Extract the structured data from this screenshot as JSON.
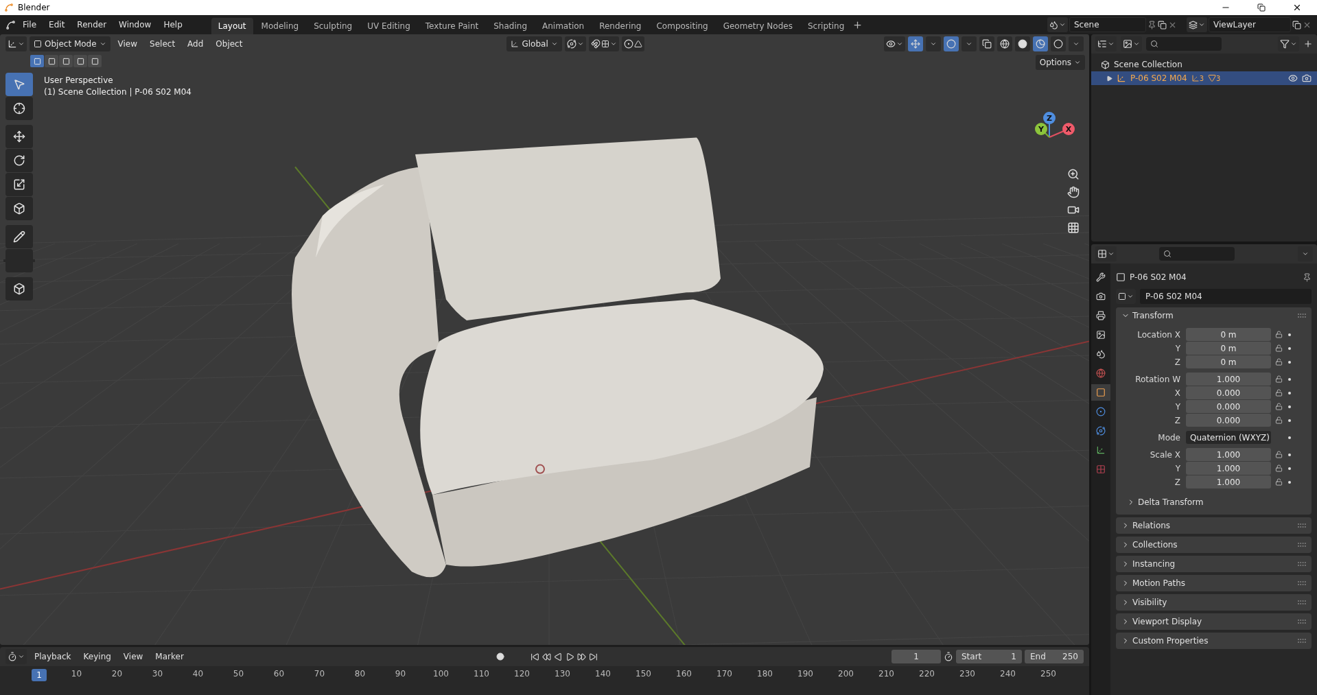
{
  "window": {
    "title": "Blender"
  },
  "menu": [
    "File",
    "Edit",
    "Render",
    "Window",
    "Help"
  ],
  "workspaces": [
    {
      "label": "Layout",
      "selected": true
    },
    {
      "label": "Modeling",
      "selected": false
    },
    {
      "label": "Sculpting",
      "selected": false
    },
    {
      "label": "UV Editing",
      "selected": false
    },
    {
      "label": "Texture Paint",
      "selected": false
    },
    {
      "label": "Shading",
      "selected": false
    },
    {
      "label": "Animation",
      "selected": false
    },
    {
      "label": "Rendering",
      "selected": false
    },
    {
      "label": "Compositing",
      "selected": false
    },
    {
      "label": "Geometry Nodes",
      "selected": false
    },
    {
      "label": "Scripting",
      "selected": false
    }
  ],
  "scene": {
    "name": "Scene"
  },
  "view_layer": {
    "name": "ViewLayer"
  },
  "viewport": {
    "mode": "Object Mode",
    "menu": [
      "View",
      "Select",
      "Add",
      "Object"
    ],
    "orientation": "Global",
    "options": "Options",
    "perspective": "User Perspective",
    "info": "(1) Scene Collection | P-06 S02 M04",
    "select_modes": [
      {
        "selected": true
      },
      {
        "selected": false
      },
      {
        "selected": false
      },
      {
        "selected": false
      },
      {
        "selected": false
      }
    ],
    "tools": [
      {
        "selected": true
      },
      {
        "selected": false
      },
      {
        "selected": false
      },
      {
        "selected": false
      },
      {
        "selected": false
      },
      {
        "selected": false
      },
      {
        "selected": false
      },
      {
        "selected": false
      },
      {
        "selected": false
      }
    ],
    "shading": [
      {
        "selected": false
      },
      {
        "selected": false
      },
      {
        "selected": true
      },
      {
        "selected": false
      }
    ],
    "gizmo": [
      "Z",
      "Y",
      "X"
    ]
  },
  "outliner": {
    "root": "Scene Collection",
    "items": [
      {
        "name": "P-06 S02 M04",
        "selected": true,
        "expanded": false,
        "counts": [
          "3",
          "3"
        ]
      }
    ]
  },
  "properties": {
    "tabs": [
      {
        "selected": false
      },
      {
        "selected": false
      },
      {
        "selected": false
      },
      {
        "selected": false
      },
      {
        "selected": false
      },
      {
        "selected": false
      },
      {
        "selected": true
      },
      {
        "selected": false
      },
      {
        "selected": false
      },
      {
        "selected": false
      },
      {
        "selected": false
      }
    ],
    "object_name": "P-06 S02 M04",
    "data_name": "P-06 S02 M04",
    "transform": {
      "title": "Transform",
      "expanded": true,
      "groups": [
        {
          "rows": [
            {
              "kind": "field",
              "label": "Location X",
              "value": "0 m"
            },
            {
              "kind": "field",
              "label": "Y",
              "value": "0 m"
            },
            {
              "kind": "field",
              "label": "Z",
              "value": "0 m"
            }
          ]
        },
        {
          "rows": [
            {
              "kind": "field",
              "label": "Rotation W",
              "value": "1.000"
            },
            {
              "kind": "field",
              "label": "X",
              "value": "0.000"
            },
            {
              "kind": "field",
              "label": "Y",
              "value": "0.000"
            },
            {
              "kind": "field",
              "label": "Z",
              "value": "0.000"
            }
          ]
        },
        {
          "rows": [
            {
              "kind": "dropdown",
              "label": "Mode",
              "value": "Quaternion (WXYZ)"
            }
          ]
        },
        {
          "rows": [
            {
              "kind": "field",
              "label": "Scale X",
              "value": "1.000"
            },
            {
              "kind": "field",
              "label": "Y",
              "value": "1.000"
            },
            {
              "kind": "field",
              "label": "Z",
              "value": "1.000"
            }
          ]
        }
      ],
      "subpanel": "Delta Transform"
    },
    "panels": [
      "Relations",
      "Collections",
      "Instancing",
      "Motion Paths",
      "Visibility",
      "Viewport Display",
      "Custom Properties"
    ]
  },
  "timeline": {
    "menu": [
      "Playback",
      "Keying",
      "View",
      "Marker"
    ],
    "current_frame": "1",
    "start_label": "Start",
    "start": "1",
    "end_label": "End",
    "end": "250",
    "playhead": "1",
    "ticks": [
      "10",
      "20",
      "30",
      "40",
      "50",
      "60",
      "70",
      "80",
      "90",
      "100",
      "110",
      "120",
      "130",
      "140",
      "150",
      "160",
      "170",
      "180",
      "190",
      "200",
      "210",
      "220",
      "230",
      "240",
      "250"
    ]
  }
}
